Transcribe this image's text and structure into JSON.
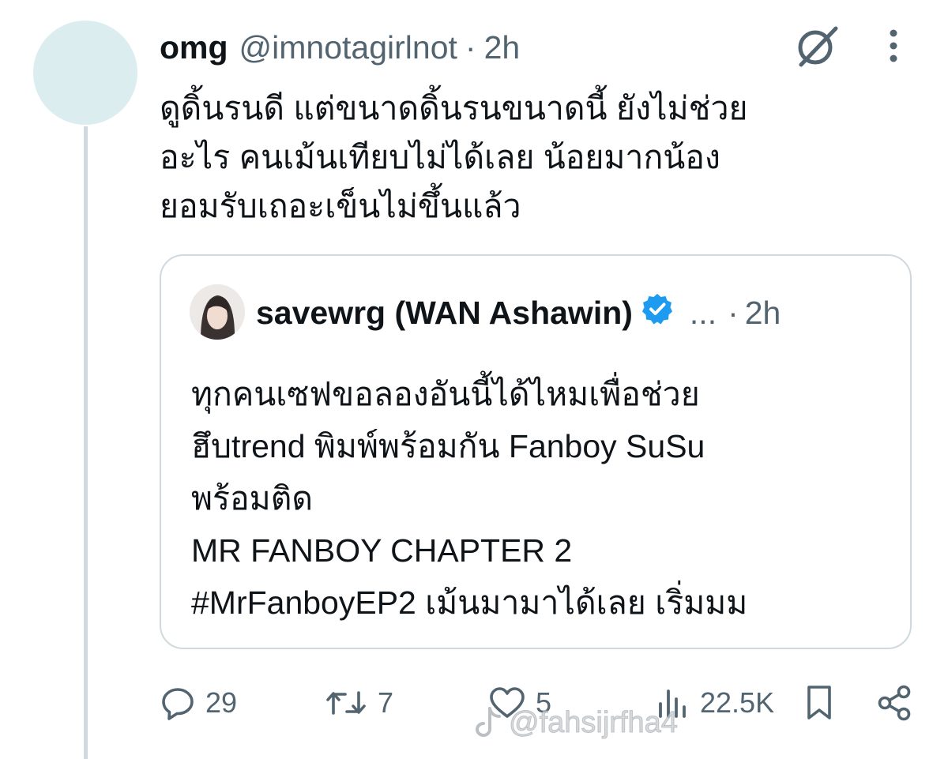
{
  "tweet": {
    "author_name": "omg",
    "author_handle": "@imnotagirlnot",
    "separator": "·",
    "time": "2h",
    "text_lines": [
      "ดูดิ้นรนดี แต่ขนาดดิ้นรนขนาดนี้ ยังไม่ช่วย",
      "อะไร คนเม้นเทียบไม่ได้เลย น้อยมากน้อง",
      "ยอมรับเถอะเข็นไม่ขึ้นแล้ว"
    ]
  },
  "quote": {
    "author_name": "savewrg (WAN Ashawin)",
    "ellipsis": "...",
    "separator": "·",
    "time": "2h",
    "text_lines": [
      "ทุกคนเซฟขอลองอันนี้ได้ไหมเพื่อช่วย",
      "ฮึบtrend พิมพ์พร้อมกัน Fanboy SuSu",
      "พร้อมติด",
      "MR FANBOY CHAPTER 2",
      "#MrFanboyEP2 เม้นมามาได้เลย เริ่มมม"
    ]
  },
  "actions": {
    "replies": "29",
    "reposts": "7",
    "likes": "5",
    "views": "22.5K"
  },
  "watermark": "@fahsijrfha4",
  "colors": {
    "text": "#0f1419",
    "secondary": "#536471",
    "border": "#cfd9de",
    "verified": "#1d9bf0",
    "avatar_bg": "#dcedf0"
  }
}
